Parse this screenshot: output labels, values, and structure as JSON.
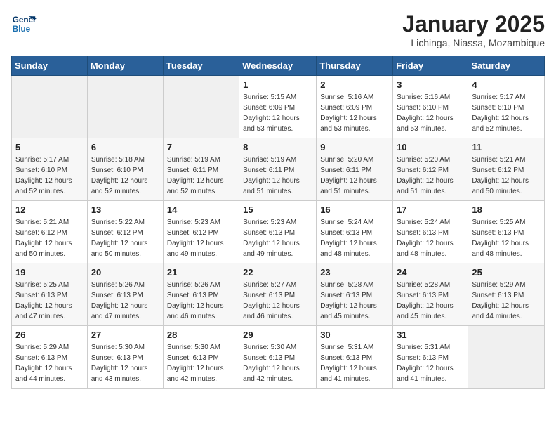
{
  "logo": {
    "line1": "General",
    "line2": "Blue"
  },
  "title": "January 2025",
  "subtitle": "Lichinga, Niassa, Mozambique",
  "weekdays": [
    "Sunday",
    "Monday",
    "Tuesday",
    "Wednesday",
    "Thursday",
    "Friday",
    "Saturday"
  ],
  "weeks": [
    [
      {
        "day": "",
        "info": ""
      },
      {
        "day": "",
        "info": ""
      },
      {
        "day": "",
        "info": ""
      },
      {
        "day": "1",
        "info": "Sunrise: 5:15 AM\nSunset: 6:09 PM\nDaylight: 12 hours\nand 53 minutes."
      },
      {
        "day": "2",
        "info": "Sunrise: 5:16 AM\nSunset: 6:09 PM\nDaylight: 12 hours\nand 53 minutes."
      },
      {
        "day": "3",
        "info": "Sunrise: 5:16 AM\nSunset: 6:10 PM\nDaylight: 12 hours\nand 53 minutes."
      },
      {
        "day": "4",
        "info": "Sunrise: 5:17 AM\nSunset: 6:10 PM\nDaylight: 12 hours\nand 52 minutes."
      }
    ],
    [
      {
        "day": "5",
        "info": "Sunrise: 5:17 AM\nSunset: 6:10 PM\nDaylight: 12 hours\nand 52 minutes."
      },
      {
        "day": "6",
        "info": "Sunrise: 5:18 AM\nSunset: 6:10 PM\nDaylight: 12 hours\nand 52 minutes."
      },
      {
        "day": "7",
        "info": "Sunrise: 5:19 AM\nSunset: 6:11 PM\nDaylight: 12 hours\nand 52 minutes."
      },
      {
        "day": "8",
        "info": "Sunrise: 5:19 AM\nSunset: 6:11 PM\nDaylight: 12 hours\nand 51 minutes."
      },
      {
        "day": "9",
        "info": "Sunrise: 5:20 AM\nSunset: 6:11 PM\nDaylight: 12 hours\nand 51 minutes."
      },
      {
        "day": "10",
        "info": "Sunrise: 5:20 AM\nSunset: 6:12 PM\nDaylight: 12 hours\nand 51 minutes."
      },
      {
        "day": "11",
        "info": "Sunrise: 5:21 AM\nSunset: 6:12 PM\nDaylight: 12 hours\nand 50 minutes."
      }
    ],
    [
      {
        "day": "12",
        "info": "Sunrise: 5:21 AM\nSunset: 6:12 PM\nDaylight: 12 hours\nand 50 minutes."
      },
      {
        "day": "13",
        "info": "Sunrise: 5:22 AM\nSunset: 6:12 PM\nDaylight: 12 hours\nand 50 minutes."
      },
      {
        "day": "14",
        "info": "Sunrise: 5:23 AM\nSunset: 6:12 PM\nDaylight: 12 hours\nand 49 minutes."
      },
      {
        "day": "15",
        "info": "Sunrise: 5:23 AM\nSunset: 6:13 PM\nDaylight: 12 hours\nand 49 minutes."
      },
      {
        "day": "16",
        "info": "Sunrise: 5:24 AM\nSunset: 6:13 PM\nDaylight: 12 hours\nand 48 minutes."
      },
      {
        "day": "17",
        "info": "Sunrise: 5:24 AM\nSunset: 6:13 PM\nDaylight: 12 hours\nand 48 minutes."
      },
      {
        "day": "18",
        "info": "Sunrise: 5:25 AM\nSunset: 6:13 PM\nDaylight: 12 hours\nand 48 minutes."
      }
    ],
    [
      {
        "day": "19",
        "info": "Sunrise: 5:25 AM\nSunset: 6:13 PM\nDaylight: 12 hours\nand 47 minutes."
      },
      {
        "day": "20",
        "info": "Sunrise: 5:26 AM\nSunset: 6:13 PM\nDaylight: 12 hours\nand 47 minutes."
      },
      {
        "day": "21",
        "info": "Sunrise: 5:26 AM\nSunset: 6:13 PM\nDaylight: 12 hours\nand 46 minutes."
      },
      {
        "day": "22",
        "info": "Sunrise: 5:27 AM\nSunset: 6:13 PM\nDaylight: 12 hours\nand 46 minutes."
      },
      {
        "day": "23",
        "info": "Sunrise: 5:28 AM\nSunset: 6:13 PM\nDaylight: 12 hours\nand 45 minutes."
      },
      {
        "day": "24",
        "info": "Sunrise: 5:28 AM\nSunset: 6:13 PM\nDaylight: 12 hours\nand 45 minutes."
      },
      {
        "day": "25",
        "info": "Sunrise: 5:29 AM\nSunset: 6:13 PM\nDaylight: 12 hours\nand 44 minutes."
      }
    ],
    [
      {
        "day": "26",
        "info": "Sunrise: 5:29 AM\nSunset: 6:13 PM\nDaylight: 12 hours\nand 44 minutes."
      },
      {
        "day": "27",
        "info": "Sunrise: 5:30 AM\nSunset: 6:13 PM\nDaylight: 12 hours\nand 43 minutes."
      },
      {
        "day": "28",
        "info": "Sunrise: 5:30 AM\nSunset: 6:13 PM\nDaylight: 12 hours\nand 42 minutes."
      },
      {
        "day": "29",
        "info": "Sunrise: 5:30 AM\nSunset: 6:13 PM\nDaylight: 12 hours\nand 42 minutes."
      },
      {
        "day": "30",
        "info": "Sunrise: 5:31 AM\nSunset: 6:13 PM\nDaylight: 12 hours\nand 41 minutes."
      },
      {
        "day": "31",
        "info": "Sunrise: 5:31 AM\nSunset: 6:13 PM\nDaylight: 12 hours\nand 41 minutes."
      },
      {
        "day": "",
        "info": ""
      }
    ]
  ]
}
